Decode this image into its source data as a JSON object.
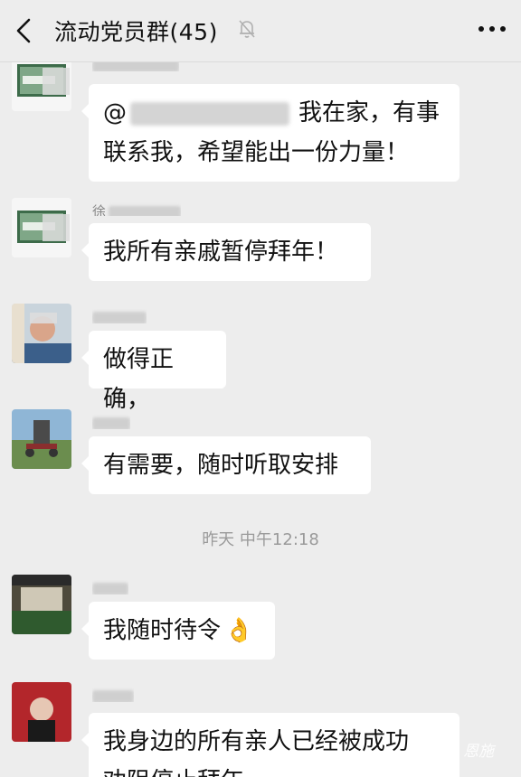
{
  "header": {
    "title": "流动党员群(45)"
  },
  "messages": [
    {
      "text_after_mention": "我在家，有事",
      "text_line2": "联系我，希望能出一份力量！",
      "mention_prefix": "@"
    },
    {
      "text": "我所有亲戚暂停拜年！",
      "sender_visible": "徐"
    },
    {
      "text": "做得正确，"
    },
    {
      "text": "有需要，随时听取安排"
    },
    {
      "text": "我随时待令",
      "emoji": "👌"
    },
    {
      "text_line1": "我身边的所有亲人已经被成功",
      "text_line2": "劝阻停止拜年"
    }
  ],
  "timestamp": "昨天 中午12:18",
  "watermark": "恩施"
}
